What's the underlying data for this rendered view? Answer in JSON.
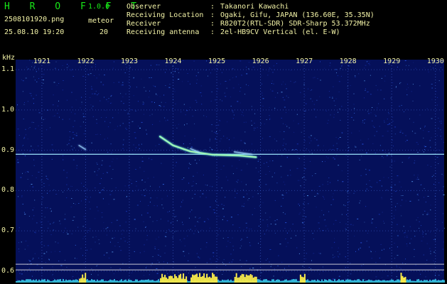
{
  "header": {
    "brand": "H R O F F T",
    "version": "1.0.0",
    "filename": "2508101920.png",
    "datetime": "25.08.10 19:20",
    "meteor_label": "meteor",
    "meteor_count": "20",
    "info": [
      {
        "label": "Observer",
        "sep": ":",
        "value": "Takanori Kawachi"
      },
      {
        "label": "Receiving Location",
        "sep": ":",
        "value": "Ogaki, Gifu, JAPAN (136.60E, 35.35N)"
      },
      {
        "label": "Receiver",
        "sep": ":",
        "value": "R820T2(RTL-SDR) SDR-Sharp 53.372MHz"
      },
      {
        "label": "Receiving antenna",
        "sep": ":",
        "value": "2el-HB9CV Vertical (el. E-W)"
      }
    ]
  },
  "colors": {
    "background": "#000000",
    "spectrogram_base": "#05105a",
    "brand_green": "#18e818",
    "label_yellow": "#f4f4a8",
    "carrier_cyan": "#9fe6ff",
    "activity_yellow": "#f5e84a",
    "activity_cyan": "#38c8e8"
  },
  "chart_data": {
    "type": "heatmap",
    "x": {
      "ticks": [
        "1921",
        "1922",
        "1923",
        "1924",
        "1925",
        "1926",
        "1927",
        "1928",
        "1929",
        "1930"
      ],
      "range": [
        1920.4,
        1930.2
      ]
    },
    "y": {
      "unit": "kHz",
      "ticks": [
        "1.1",
        "1.0",
        "0.9",
        "0.8",
        "0.7",
        "0.6"
      ],
      "range": [
        0.575,
        1.125
      ]
    },
    "reference_lines_khz": [
      0.89,
      0.617,
      0.603
    ],
    "echoes": [
      {
        "points": [
          [
            1921.85,
            0.912
          ],
          [
            1922.0,
            0.902
          ]
        ],
        "intensity": "weak"
      },
      {
        "points": [
          [
            1923.7,
            0.934
          ],
          [
            1924.0,
            0.912
          ],
          [
            1924.4,
            0.897
          ],
          [
            1924.9,
            0.889
          ],
          [
            1925.5,
            0.887
          ],
          [
            1925.9,
            0.883
          ]
        ],
        "intensity": "strong"
      },
      {
        "points": [
          [
            1924.4,
            0.904
          ],
          [
            1924.6,
            0.895
          ]
        ],
        "intensity": "weak"
      },
      {
        "points": [
          [
            1925.4,
            0.896
          ],
          [
            1925.8,
            0.89
          ]
        ],
        "intensity": "weak"
      }
    ]
  }
}
